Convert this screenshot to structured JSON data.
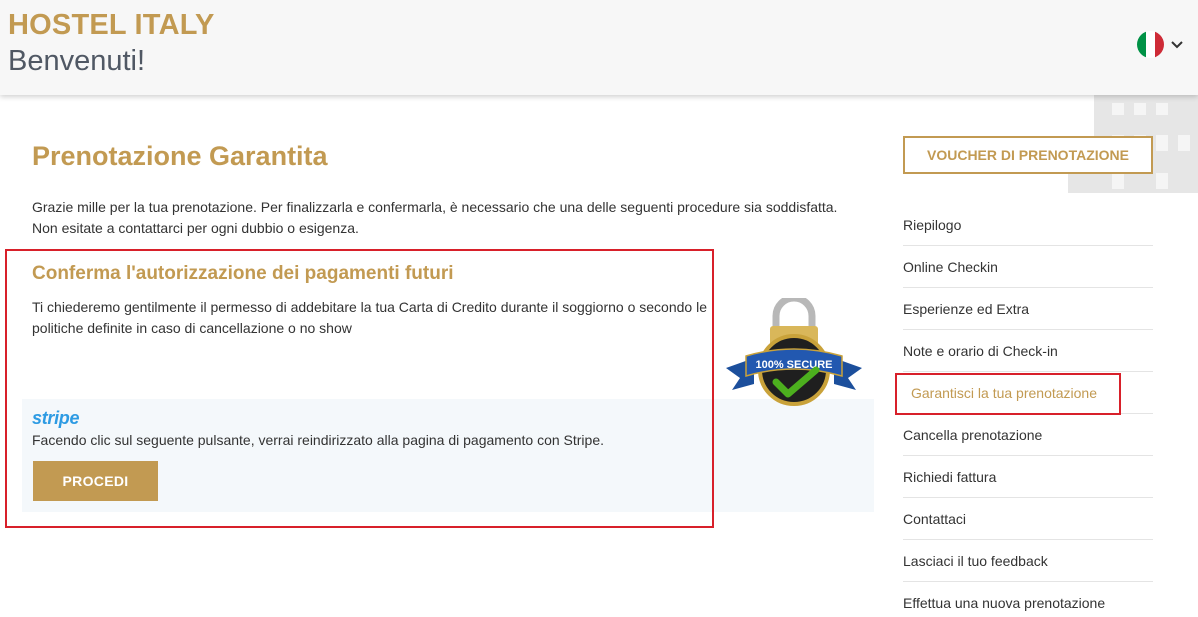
{
  "header": {
    "brand": "HOSTEL ITALY",
    "welcome": "Benvenuti!",
    "language_flag": "italy-flag-icon"
  },
  "main": {
    "title": "Prenotazione Garantita",
    "intro_line1": "Grazie mille per la tua prenotazione. Per finalizzarla e confermarla, è necessario che una delle seguenti procedure sia soddisfatta.",
    "intro_line2": "Non esitate a contattarci per ogni dubbio o esigenza.",
    "panel": {
      "title": "Conferma l'autorizzazione dei pagamenti futuri",
      "text": "Ti chiederemo gentilmente il permesso di addebitare la tua Carta di Credito durante il soggiorno o secondo le politiche definite in caso di cancellazione o no show",
      "secure_badge": "100% SECURE"
    },
    "stripe": {
      "logo": "stripe",
      "text": "Facendo clic sul seguente pulsante, verrai reindirizzato alla pagina di pagamento con Stripe.",
      "button": "PROCEDI"
    }
  },
  "sidebar": {
    "voucher_button": "VOUCHER DI PRENOTAZIONE",
    "items": [
      {
        "label": "Riepilogo"
      },
      {
        "label": "Online Checkin"
      },
      {
        "label": "Esperienze ed Extra"
      },
      {
        "label": "Note e orario di Check-in"
      },
      {
        "label": "Garantisci la tua prenotazione"
      },
      {
        "label": "Cancella prenotazione"
      },
      {
        "label": "Richiedi fattura"
      },
      {
        "label": "Contattaci"
      },
      {
        "label": "Lasciaci il tuo feedback"
      },
      {
        "label": "Effettua una nuova prenotazione"
      }
    ],
    "active_index": 4
  },
  "colors": {
    "accent": "#c29a52",
    "highlight_border": "#d8202a",
    "stripe_blue": "#2d9be3"
  }
}
